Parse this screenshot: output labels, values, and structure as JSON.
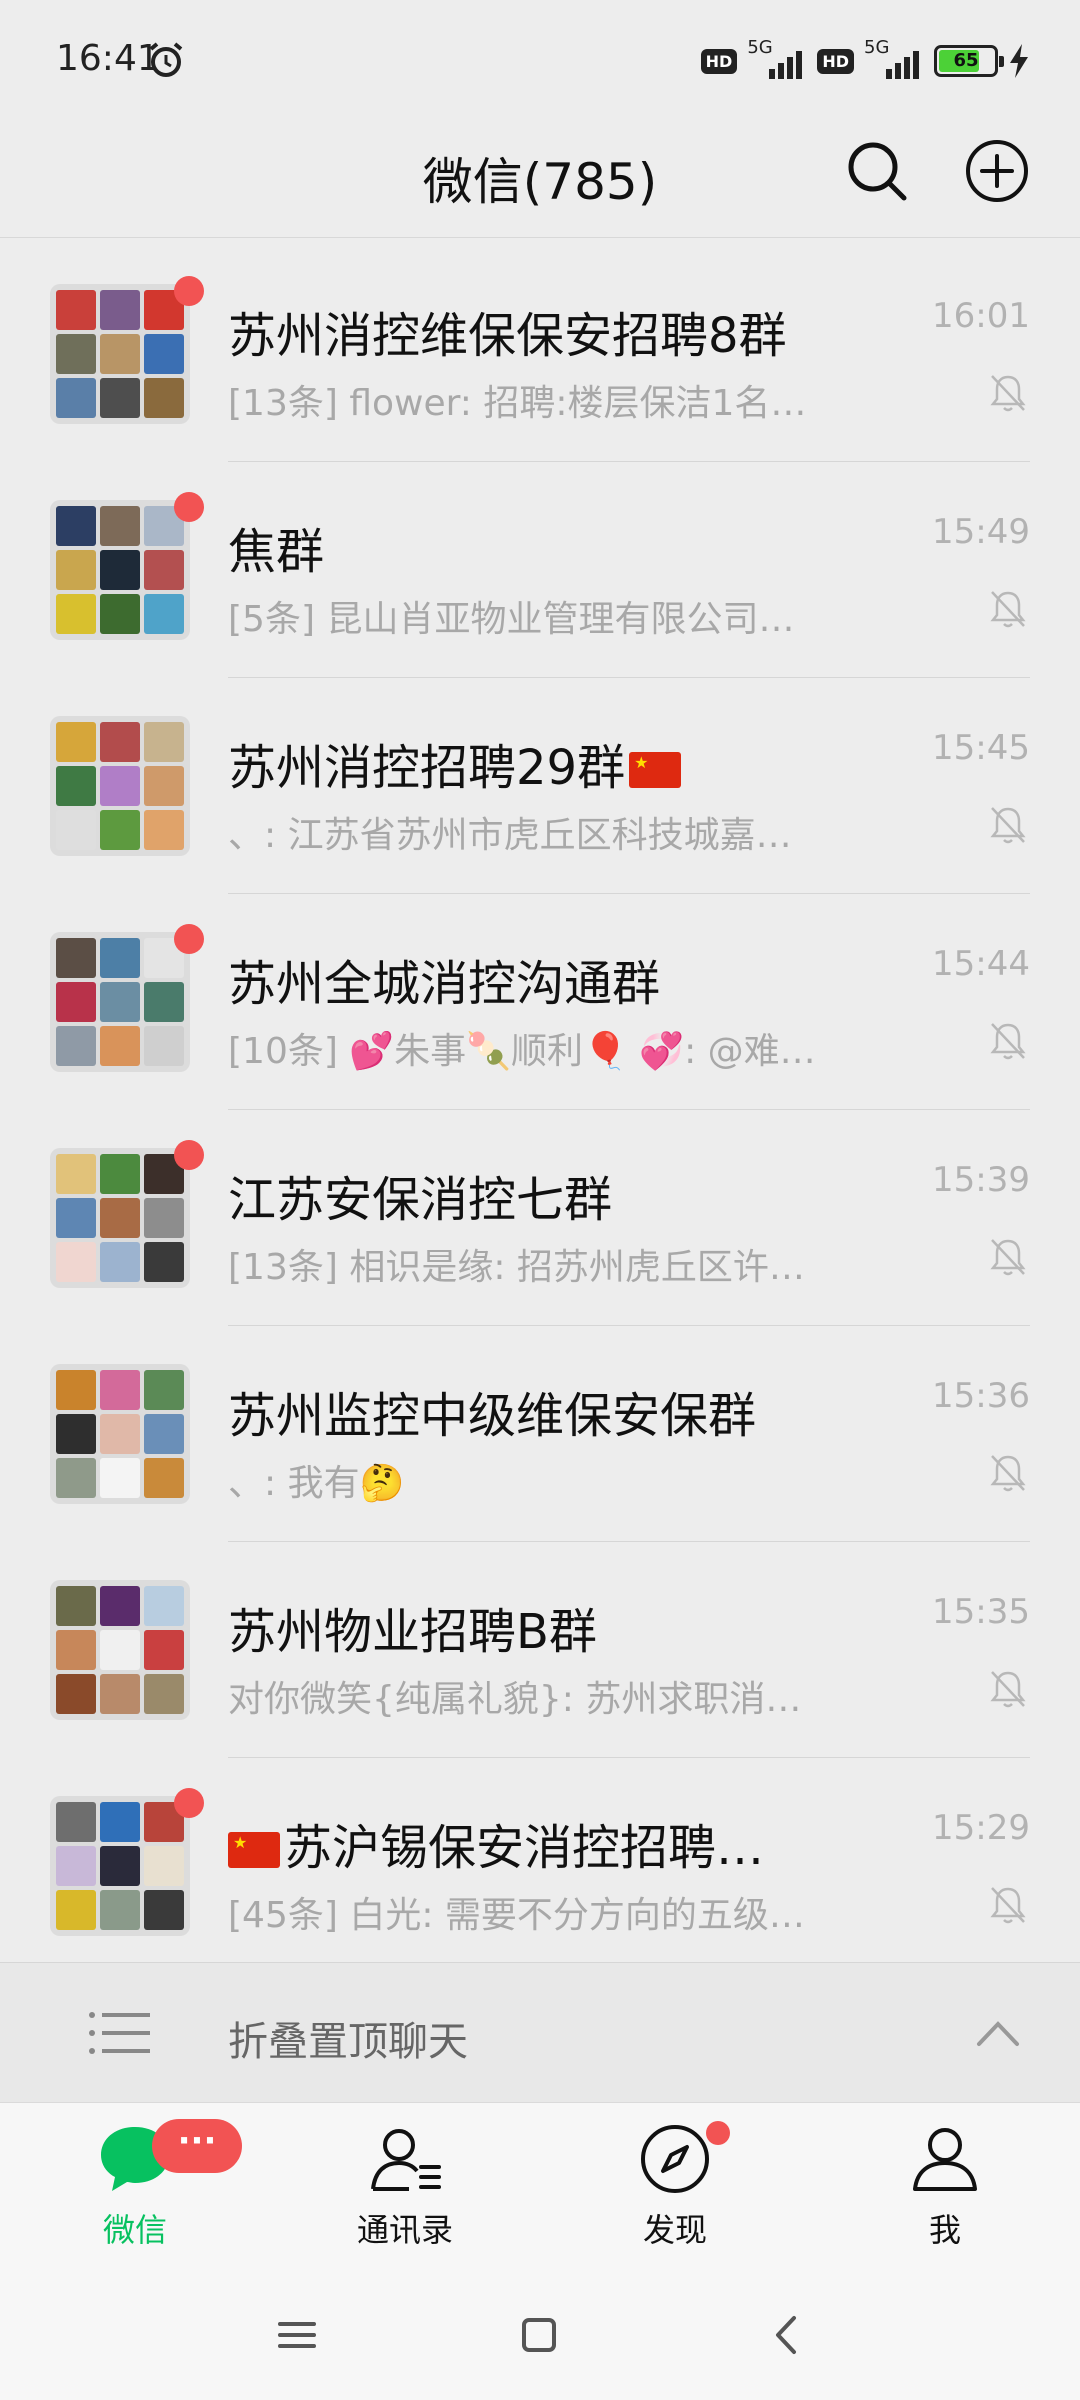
{
  "status_bar": {
    "time": "16:41",
    "network_1": "5G",
    "network_2": "5G",
    "hd_1": "HD",
    "hd_2": "HD",
    "battery_level": "65"
  },
  "header": {
    "title": "微信(785)"
  },
  "chats": [
    {
      "name": "苏州消控维保保安招聘8群",
      "time": "16:01",
      "preview": "[13条] flower: 招聘:楼层保洁1名…",
      "unread": true,
      "muted": true
    },
    {
      "name": "焦群",
      "time": "15:49",
      "preview": "[5条] 昆山肖亚物业管理有限公司…",
      "unread": true,
      "muted": true
    },
    {
      "name": "苏州消控招聘29群",
      "time": "15:45",
      "preview": "、: 江苏省苏州市虎丘区科技城嘉…",
      "unread": false,
      "muted": true
    },
    {
      "name": "苏州全城消控沟通群",
      "time": "15:44",
      "preview": "[10条] 💕朱事🍡顺利🎈 💞: @难…",
      "unread": true,
      "muted": true
    },
    {
      "name": "江苏安保消控七群",
      "time": "15:39",
      "preview": "[13条] 相识是缘: 招苏州虎丘区许…",
      "unread": true,
      "muted": true
    },
    {
      "name": "苏州监控中级维保安保群",
      "time": "15:36",
      "preview": "、: 我有🤔",
      "unread": false,
      "muted": true
    },
    {
      "name": "苏州物业招聘B群",
      "time": "15:35",
      "preview": "对你微笑{纯属礼貌}: 苏州求职消…",
      "unread": false,
      "muted": true
    },
    {
      "name": "苏沪锡保安消控招聘…",
      "time": "15:29",
      "preview": "[45条] 白光: 需要不分方向的五级…",
      "unread": true,
      "muted": true
    }
  ],
  "fold": {
    "label": "折叠置顶聊天"
  },
  "tabs": [
    {
      "label": "微信",
      "badge": "···"
    },
    {
      "label": "通讯录"
    },
    {
      "label": "发现"
    },
    {
      "label": "我"
    }
  ],
  "colors": {
    "accent": "#07c160",
    "badge": "#f25353",
    "background": "#ededed"
  }
}
